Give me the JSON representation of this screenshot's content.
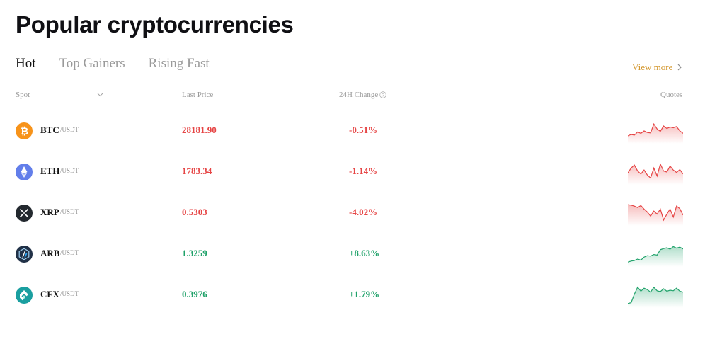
{
  "page": {
    "title": "Popular cryptocurrencies"
  },
  "tabs": [
    {
      "label": "Hot",
      "active": true
    },
    {
      "label": "Top Gainers",
      "active": false
    },
    {
      "label": "Rising Fast",
      "active": false
    }
  ],
  "view_more": {
    "label": "View more"
  },
  "table": {
    "headers": {
      "spot": "Spot",
      "last_price": "Last Price",
      "change_24h": "24H Change",
      "quotes": "Quotes"
    },
    "rows": [
      {
        "symbol": "BTC",
        "quote": "/USDT",
        "price": "28181.90",
        "change": "-0.51%",
        "trend": "down",
        "icon": "bitcoin-icon",
        "icon_color": "#f7931a",
        "spark": [
          0.25,
          0.32,
          0.29,
          0.45,
          0.38,
          0.5,
          0.42,
          0.4,
          0.85,
          0.6,
          0.48,
          0.75,
          0.62,
          0.7,
          0.66,
          0.72,
          0.5,
          0.38
        ]
      },
      {
        "symbol": "ETH",
        "quote": "/USDT",
        "price": "1783.34",
        "change": "-1.14%",
        "trend": "down",
        "icon": "ethereum-icon",
        "icon_color": "#627eea",
        "spark": [
          0.45,
          0.7,
          0.85,
          0.55,
          0.4,
          0.6,
          0.35,
          0.2,
          0.7,
          0.3,
          0.9,
          0.55,
          0.5,
          0.8,
          0.6,
          0.48,
          0.62,
          0.4
        ]
      },
      {
        "symbol": "XRP",
        "quote": "/USDT",
        "price": "0.5303",
        "change": "-4.02%",
        "trend": "down",
        "icon": "xrp-icon",
        "icon_color": "#23292f",
        "spark": [
          0.92,
          0.9,
          0.85,
          0.78,
          0.88,
          0.7,
          0.55,
          0.35,
          0.6,
          0.45,
          0.7,
          0.15,
          0.45,
          0.7,
          0.3,
          0.85,
          0.72,
          0.4
        ]
      },
      {
        "symbol": "ARB",
        "quote": "/USDT",
        "price": "1.3259",
        "change": "+8.63%",
        "trend": "up",
        "icon": "arbitrum-icon",
        "icon_color": "#213147",
        "spark": [
          0.1,
          0.15,
          0.18,
          0.25,
          0.2,
          0.35,
          0.42,
          0.4,
          0.48,
          0.45,
          0.72,
          0.78,
          0.82,
          0.75,
          0.88,
          0.8,
          0.85,
          0.76
        ]
      },
      {
        "symbol": "CFX",
        "quote": "/USDT",
        "price": "0.3976",
        "change": "+1.79%",
        "trend": "up",
        "icon": "conflux-icon",
        "icon_color": "#1a9fa0",
        "spark": [
          0.08,
          0.12,
          0.55,
          0.9,
          0.7,
          0.85,
          0.78,
          0.65,
          0.9,
          0.72,
          0.68,
          0.82,
          0.7,
          0.75,
          0.72,
          0.85,
          0.7,
          0.65
        ]
      }
    ]
  },
  "colors": {
    "down": "#e64545",
    "up": "#20a26a",
    "accent": "#d3962b"
  }
}
